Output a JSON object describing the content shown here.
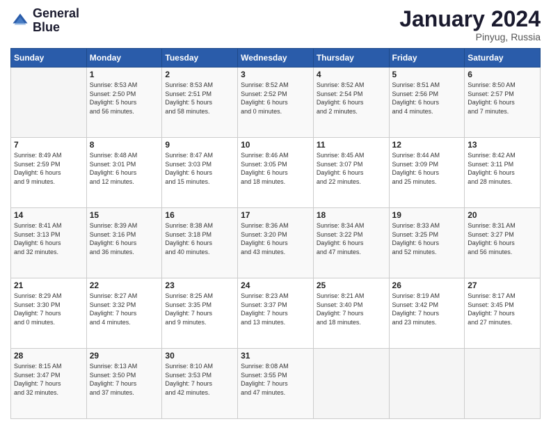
{
  "logo": {
    "line1": "General",
    "line2": "Blue"
  },
  "title": "January 2024",
  "subtitle": "Pinyug, Russia",
  "days_header": [
    "Sunday",
    "Monday",
    "Tuesday",
    "Wednesday",
    "Thursday",
    "Friday",
    "Saturday"
  ],
  "weeks": [
    [
      {
        "day": "",
        "info": ""
      },
      {
        "day": "1",
        "info": "Sunrise: 8:53 AM\nSunset: 2:50 PM\nDaylight: 5 hours\nand 56 minutes."
      },
      {
        "day": "2",
        "info": "Sunrise: 8:53 AM\nSunset: 2:51 PM\nDaylight: 5 hours\nand 58 minutes."
      },
      {
        "day": "3",
        "info": "Sunrise: 8:52 AM\nSunset: 2:52 PM\nDaylight: 6 hours\nand 0 minutes."
      },
      {
        "day": "4",
        "info": "Sunrise: 8:52 AM\nSunset: 2:54 PM\nDaylight: 6 hours\nand 2 minutes."
      },
      {
        "day": "5",
        "info": "Sunrise: 8:51 AM\nSunset: 2:56 PM\nDaylight: 6 hours\nand 4 minutes."
      },
      {
        "day": "6",
        "info": "Sunrise: 8:50 AM\nSunset: 2:57 PM\nDaylight: 6 hours\nand 7 minutes."
      }
    ],
    [
      {
        "day": "7",
        "info": "Sunrise: 8:49 AM\nSunset: 2:59 PM\nDaylight: 6 hours\nand 9 minutes."
      },
      {
        "day": "8",
        "info": "Sunrise: 8:48 AM\nSunset: 3:01 PM\nDaylight: 6 hours\nand 12 minutes."
      },
      {
        "day": "9",
        "info": "Sunrise: 8:47 AM\nSunset: 3:03 PM\nDaylight: 6 hours\nand 15 minutes."
      },
      {
        "day": "10",
        "info": "Sunrise: 8:46 AM\nSunset: 3:05 PM\nDaylight: 6 hours\nand 18 minutes."
      },
      {
        "day": "11",
        "info": "Sunrise: 8:45 AM\nSunset: 3:07 PM\nDaylight: 6 hours\nand 22 minutes."
      },
      {
        "day": "12",
        "info": "Sunrise: 8:44 AM\nSunset: 3:09 PM\nDaylight: 6 hours\nand 25 minutes."
      },
      {
        "day": "13",
        "info": "Sunrise: 8:42 AM\nSunset: 3:11 PM\nDaylight: 6 hours\nand 28 minutes."
      }
    ],
    [
      {
        "day": "14",
        "info": "Sunrise: 8:41 AM\nSunset: 3:13 PM\nDaylight: 6 hours\nand 32 minutes."
      },
      {
        "day": "15",
        "info": "Sunrise: 8:39 AM\nSunset: 3:16 PM\nDaylight: 6 hours\nand 36 minutes."
      },
      {
        "day": "16",
        "info": "Sunrise: 8:38 AM\nSunset: 3:18 PM\nDaylight: 6 hours\nand 40 minutes."
      },
      {
        "day": "17",
        "info": "Sunrise: 8:36 AM\nSunset: 3:20 PM\nDaylight: 6 hours\nand 43 minutes."
      },
      {
        "day": "18",
        "info": "Sunrise: 8:34 AM\nSunset: 3:22 PM\nDaylight: 6 hours\nand 47 minutes."
      },
      {
        "day": "19",
        "info": "Sunrise: 8:33 AM\nSunset: 3:25 PM\nDaylight: 6 hours\nand 52 minutes."
      },
      {
        "day": "20",
        "info": "Sunrise: 8:31 AM\nSunset: 3:27 PM\nDaylight: 6 hours\nand 56 minutes."
      }
    ],
    [
      {
        "day": "21",
        "info": "Sunrise: 8:29 AM\nSunset: 3:30 PM\nDaylight: 7 hours\nand 0 minutes."
      },
      {
        "day": "22",
        "info": "Sunrise: 8:27 AM\nSunset: 3:32 PM\nDaylight: 7 hours\nand 4 minutes."
      },
      {
        "day": "23",
        "info": "Sunrise: 8:25 AM\nSunset: 3:35 PM\nDaylight: 7 hours\nand 9 minutes."
      },
      {
        "day": "24",
        "info": "Sunrise: 8:23 AM\nSunset: 3:37 PM\nDaylight: 7 hours\nand 13 minutes."
      },
      {
        "day": "25",
        "info": "Sunrise: 8:21 AM\nSunset: 3:40 PM\nDaylight: 7 hours\nand 18 minutes."
      },
      {
        "day": "26",
        "info": "Sunrise: 8:19 AM\nSunset: 3:42 PM\nDaylight: 7 hours\nand 23 minutes."
      },
      {
        "day": "27",
        "info": "Sunrise: 8:17 AM\nSunset: 3:45 PM\nDaylight: 7 hours\nand 27 minutes."
      }
    ],
    [
      {
        "day": "28",
        "info": "Sunrise: 8:15 AM\nSunset: 3:47 PM\nDaylight: 7 hours\nand 32 minutes."
      },
      {
        "day": "29",
        "info": "Sunrise: 8:13 AM\nSunset: 3:50 PM\nDaylight: 7 hours\nand 37 minutes."
      },
      {
        "day": "30",
        "info": "Sunrise: 8:10 AM\nSunset: 3:53 PM\nDaylight: 7 hours\nand 42 minutes."
      },
      {
        "day": "31",
        "info": "Sunrise: 8:08 AM\nSunset: 3:55 PM\nDaylight: 7 hours\nand 47 minutes."
      },
      {
        "day": "",
        "info": ""
      },
      {
        "day": "",
        "info": ""
      },
      {
        "day": "",
        "info": ""
      }
    ]
  ]
}
